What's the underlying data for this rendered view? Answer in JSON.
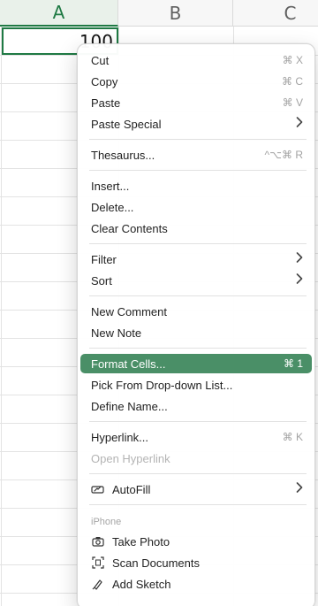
{
  "columns": [
    {
      "label": "A",
      "active": true
    },
    {
      "label": "B",
      "active": false
    },
    {
      "label": "C",
      "active": false
    }
  ],
  "cell_a1": {
    "value": "100"
  },
  "menu": {
    "groups": [
      [
        {
          "label": "Cut",
          "shortcut": "⌘ X"
        },
        {
          "label": "Copy",
          "shortcut": "⌘ C"
        },
        {
          "label": "Paste",
          "shortcut": "⌘ V"
        },
        {
          "label": "Paste Special",
          "submenu": true
        }
      ],
      [
        {
          "label": "Thesaurus...",
          "shortcut": "^⌥⌘ R"
        }
      ],
      [
        {
          "label": "Insert..."
        },
        {
          "label": "Delete..."
        },
        {
          "label": "Clear Contents"
        }
      ],
      [
        {
          "label": "Filter",
          "submenu": true
        },
        {
          "label": "Sort",
          "submenu": true
        }
      ],
      [
        {
          "label": "New Comment"
        },
        {
          "label": "New Note"
        }
      ],
      [
        {
          "label": "Format Cells...",
          "shortcut": "⌘ 1",
          "highlight": true
        },
        {
          "label": "Pick From Drop-down List..."
        },
        {
          "label": "Define Name..."
        }
      ],
      [
        {
          "label": "Hyperlink...",
          "shortcut": "⌘ K"
        },
        {
          "label": "Open Hyperlink",
          "disabled": true
        }
      ],
      [
        {
          "label": "AutoFill",
          "submenu": true,
          "icon": "autofill-icon"
        }
      ]
    ],
    "iphone_section": {
      "title": "iPhone",
      "items": [
        {
          "label": "Take Photo",
          "icon": "camera-icon"
        },
        {
          "label": "Scan Documents",
          "icon": "scan-icon"
        },
        {
          "label": "Add Sketch",
          "icon": "sketch-icon"
        }
      ]
    }
  },
  "colors": {
    "accent": "#1f7a44",
    "highlight": "#4a8f67"
  }
}
